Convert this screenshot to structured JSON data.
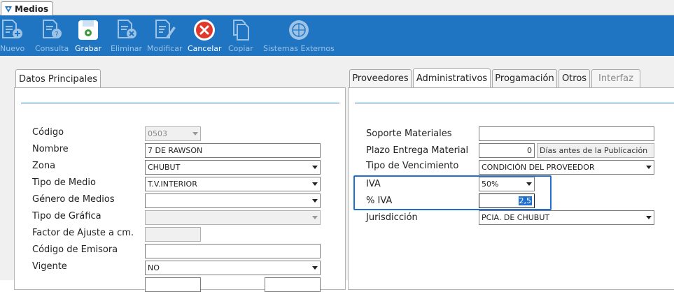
{
  "window": {
    "tab_title": "Medios"
  },
  "toolbar": {
    "buttons": [
      {
        "label": "Nuevo",
        "icon": "new-document-icon",
        "enabled": false
      },
      {
        "label": "Consulta",
        "icon": "query-document-icon",
        "enabled": false
      },
      {
        "label": "Grabar",
        "icon": "save-icon",
        "enabled": true
      },
      {
        "label": "Eliminar",
        "icon": "delete-document-icon",
        "enabled": false
      },
      {
        "label": "Modificar",
        "icon": "edit-document-icon",
        "enabled": false
      },
      {
        "label": "Cancelar",
        "icon": "cancel-icon",
        "enabled": true
      },
      {
        "label": "Copiar",
        "icon": "copy-icon",
        "enabled": false
      },
      {
        "label": "Sistemas Externos",
        "icon": "external-systems-icon",
        "enabled": false
      }
    ]
  },
  "left": {
    "tab": "Datos Principales",
    "fields": {
      "codigo": {
        "label": "Código",
        "value": "0503"
      },
      "nombre": {
        "label": "Nombre",
        "value": "7 DE RAWSON"
      },
      "zona": {
        "label": "Zona",
        "value": "CHUBUT"
      },
      "tipo_medio": {
        "label": "Tipo de Medio",
        "value": "T.V.INTERIOR"
      },
      "genero": {
        "label": "Género de Medios",
        "value": ""
      },
      "tipo_grafica": {
        "label": "Tipo de Gráfica",
        "value": ""
      },
      "factor": {
        "label": "Factor de Ajuste a cm.",
        "value": ""
      },
      "emisora": {
        "label": "Código de Emisora",
        "value": ""
      },
      "vigente": {
        "label": "Vigente",
        "value": "NO"
      }
    }
  },
  "right": {
    "tabs": [
      "Proveedores",
      "Administrativos",
      "Progamación",
      "Otros",
      "Interfaz"
    ],
    "active_tab": "Administrativos",
    "fields": {
      "soporte": {
        "label": "Soporte Materiales",
        "value": ""
      },
      "plazo": {
        "label": "Plazo Entrega Material",
        "value": "0",
        "suffix": "Días antes de la Publicación"
      },
      "vencimiento": {
        "label": "Tipo de Vencimiento",
        "value": "CONDICIÓN DEL PROVEEDOR"
      },
      "iva": {
        "label": "IVA",
        "value": "50%"
      },
      "pct_iva": {
        "label": "% IVA",
        "value": "2,5"
      },
      "jurisdiccion": {
        "label": "Jurisdicción",
        "value": "PCIA. DE CHUBUT"
      }
    }
  },
  "colors": {
    "toolbar_bg": "#1f75c2",
    "accent": "#1f6fd1",
    "cancel_red": "#e0392b"
  }
}
